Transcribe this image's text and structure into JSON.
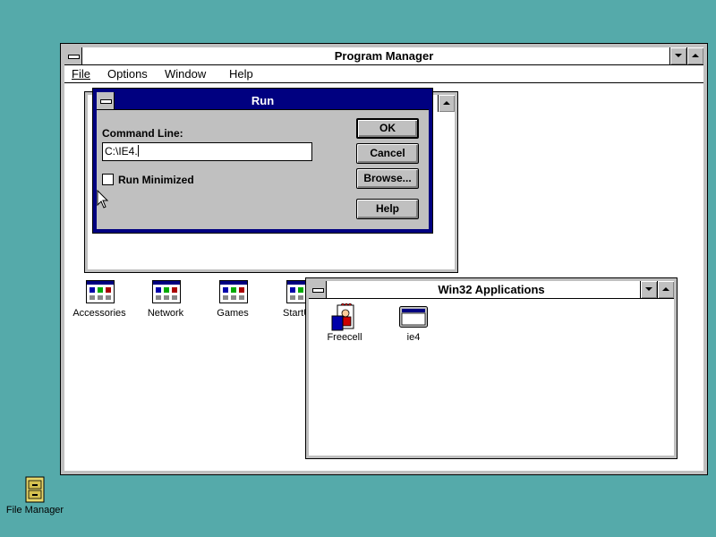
{
  "program_manager": {
    "title": "Program Manager",
    "menu": [
      "File",
      "Options",
      "Window",
      "Help"
    ]
  },
  "group_icons": [
    {
      "label": "Accessories"
    },
    {
      "label": "Network"
    },
    {
      "label": "Games"
    },
    {
      "label": "StartU"
    }
  ],
  "run_dialog": {
    "title": "Run",
    "command_label": "Command Line:",
    "command_value": "C:\\IE4.",
    "run_minimized_label": "Run Minimized",
    "run_minimized_checked": false,
    "ok_label": "OK",
    "cancel_label": "Cancel",
    "browse_label": "Browse...",
    "help_label": "Help"
  },
  "win32_group": {
    "title": "Win32 Applications",
    "items": [
      {
        "label": "Freecell",
        "icon": "freecell-icon"
      },
      {
        "label": "ie4",
        "icon": "window-app-icon"
      }
    ]
  },
  "desktop": {
    "file_manager_label": "File Manager"
  },
  "colors": {
    "desktop": "#55AAAA",
    "active_title": "#000080",
    "button_face": "#C0C0C0"
  }
}
